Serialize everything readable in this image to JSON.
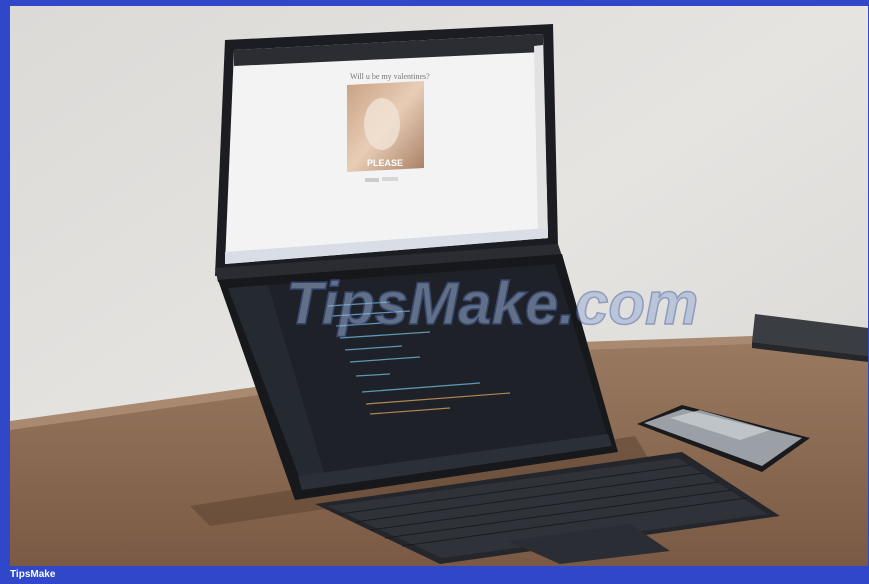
{
  "footer": {
    "brand": "TipsMake"
  },
  "photo": {
    "screen_text": {
      "heading": "Will u be my valentines?",
      "caption": "PLEASE"
    },
    "watermark": "TipsMake.com"
  },
  "colors": {
    "wall": "#e3e1de",
    "desk": "#8a6a52",
    "laptop": "#1d2026",
    "editor_bg": "#1e2228",
    "frame_border": "#2f47c8"
  }
}
